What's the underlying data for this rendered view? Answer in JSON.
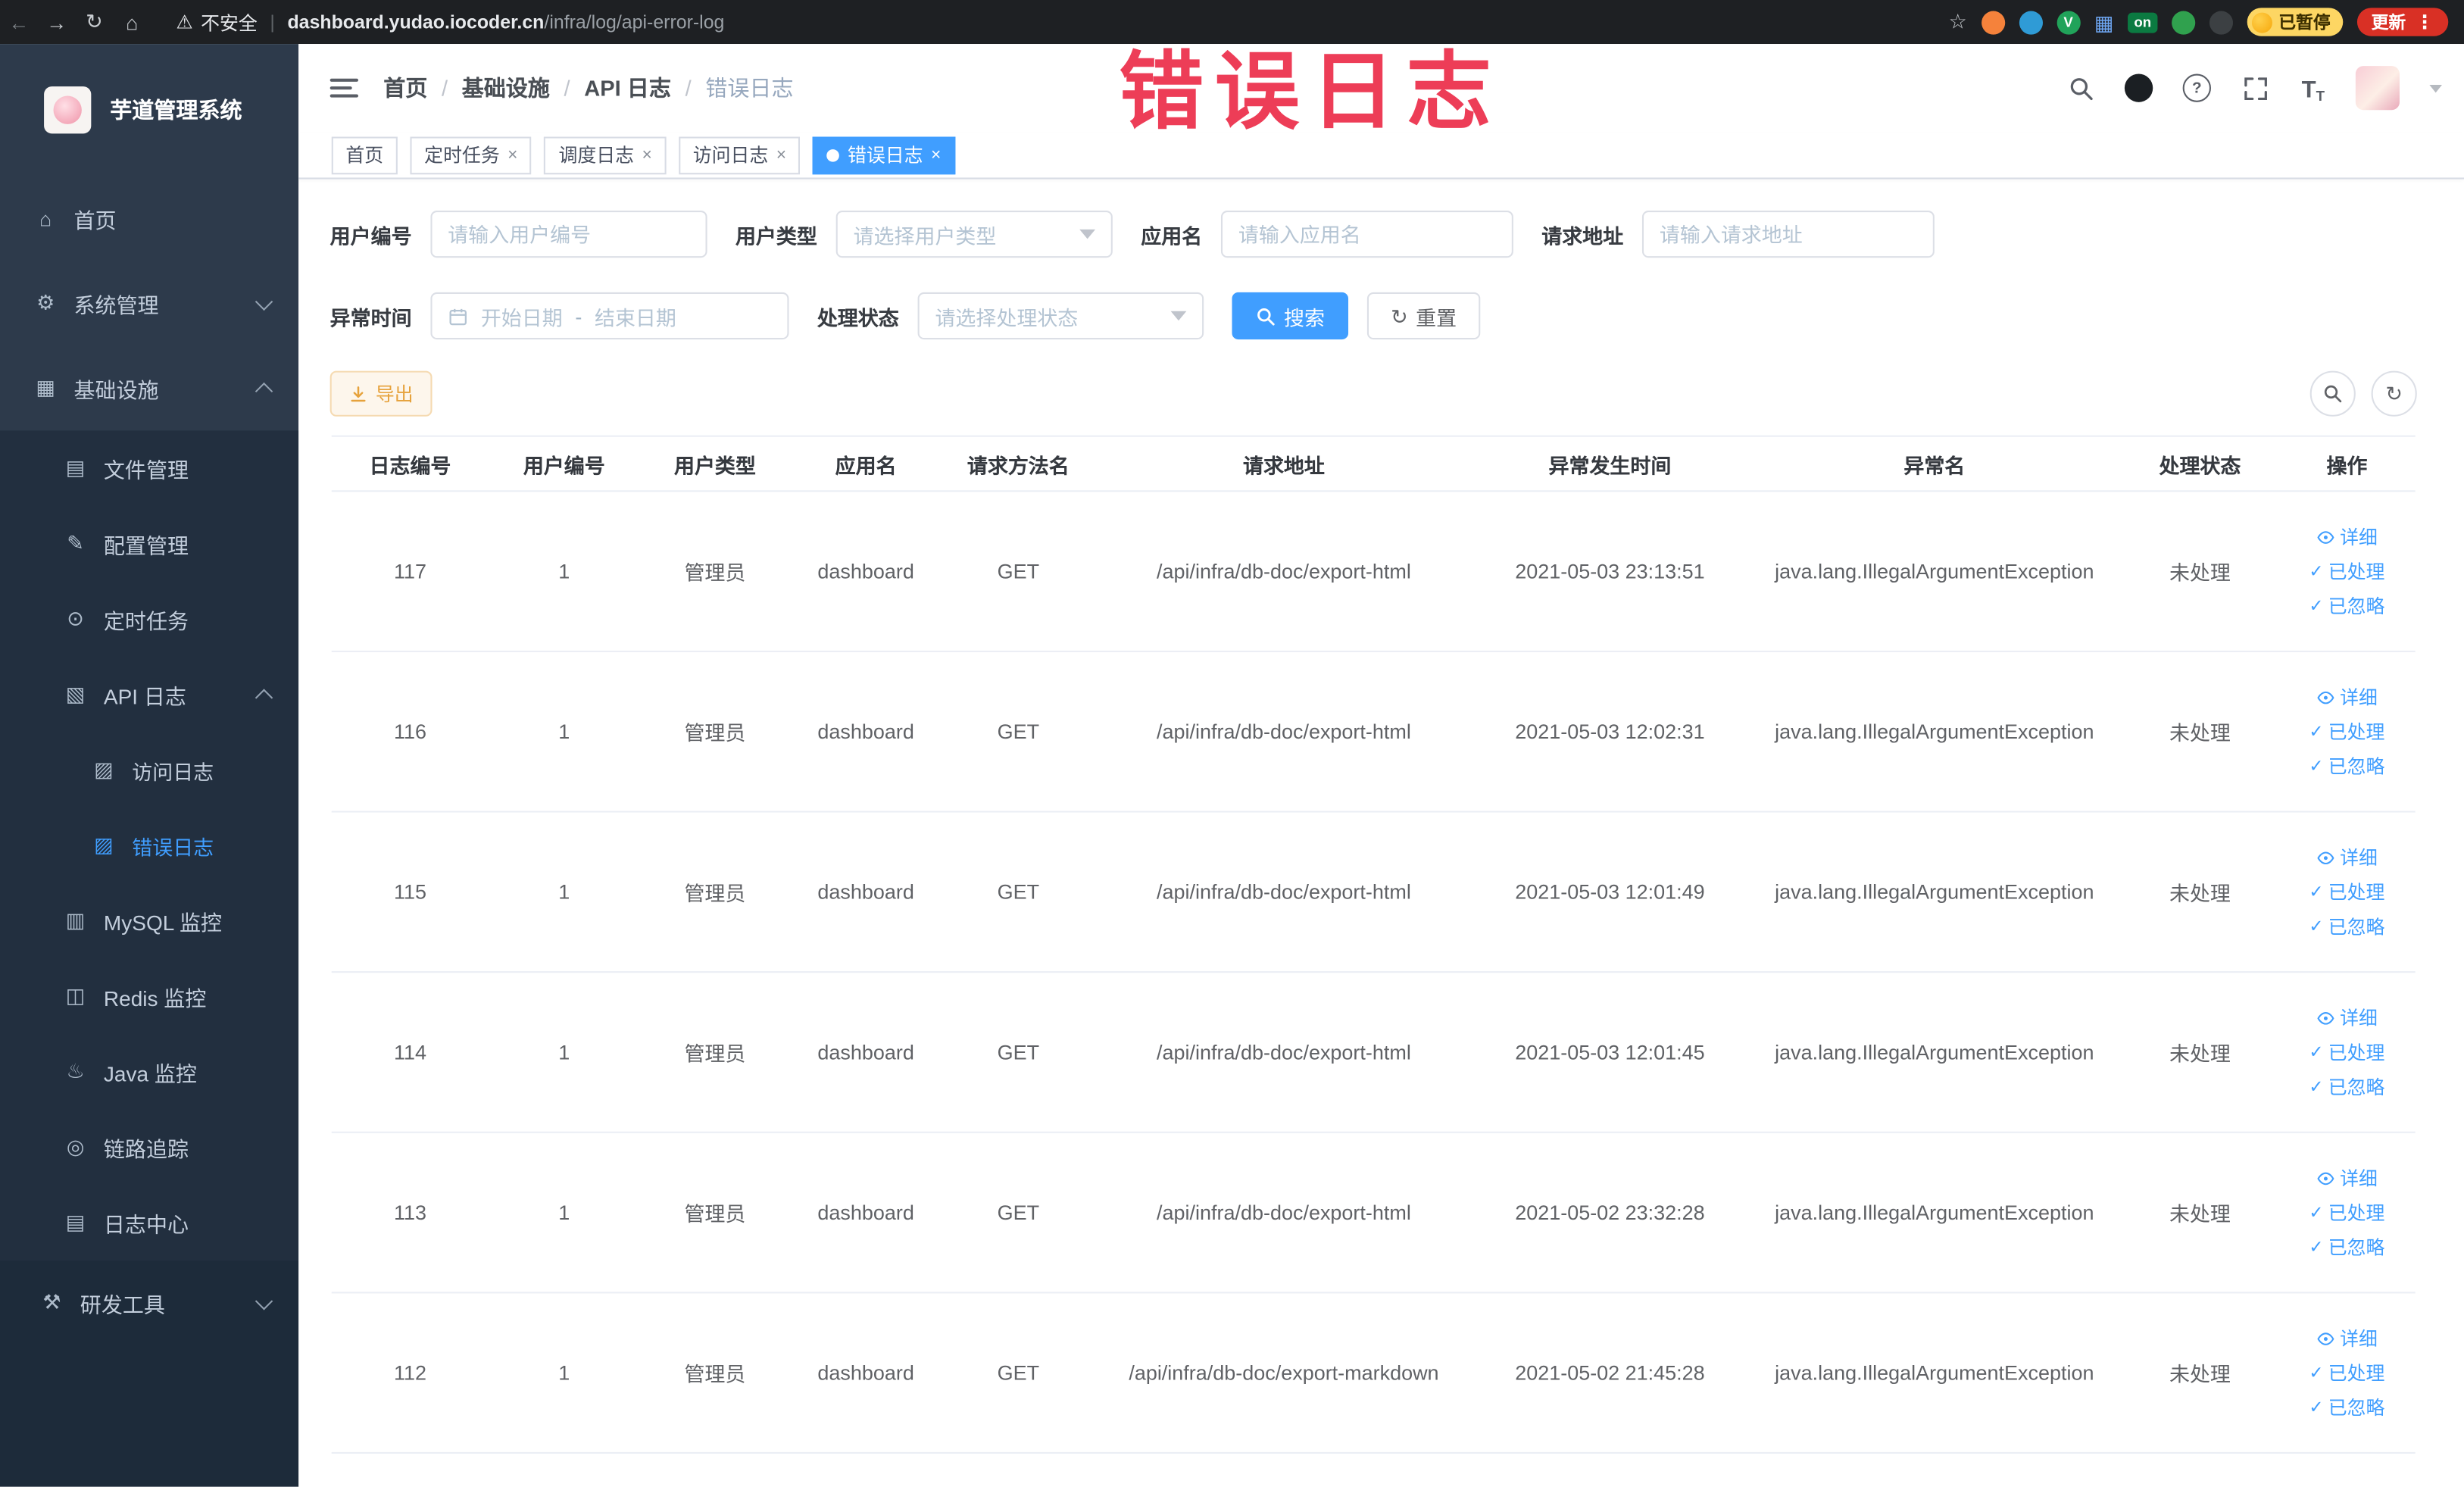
{
  "glyphs": {
    "back": "←",
    "forward": "→",
    "reload": "↻",
    "home": "⌂",
    "warning": "⚠",
    "star": "☆",
    "dots": "⋮",
    "check": "✓",
    "refresh": "↻",
    "question": "?",
    "grid": "▦",
    "close": "×",
    "download": "⤓",
    "magnifier_fallback": "⌕"
  },
  "browser": {
    "security_label": "不安全",
    "url_domain": "dashboard.yudao.iocoder.cn",
    "url_path": "/infra/log/api-error-log",
    "paused_badge": "已暂停",
    "update_label": "更新",
    "ext_on_label": "on",
    "ext_v_label": "V"
  },
  "annotation": {
    "overlay_text": "错误日志",
    "color": "#ed3d57"
  },
  "sidebar": {
    "logo_title": "芋道管理系统",
    "items": {
      "home": {
        "label": "首页",
        "glyph": "⌂"
      },
      "system": {
        "label": "系统管理",
        "glyph": "⚙"
      },
      "infra": {
        "label": "基础设施",
        "glyph": "▦"
      },
      "file": {
        "label": "文件管理",
        "glyph": "▤"
      },
      "config": {
        "label": "配置管理",
        "glyph": "✎"
      },
      "job": {
        "label": "定时任务",
        "glyph": "⊙"
      },
      "apilog": {
        "label": "API 日志",
        "glyph": "▧"
      },
      "accesslog": {
        "label": "访问日志",
        "glyph": "▨"
      },
      "errorlog": {
        "label": "错误日志",
        "glyph": "▨"
      },
      "mysql": {
        "label": "MySQL 监控",
        "glyph": "▥"
      },
      "redis": {
        "label": "Redis 监控",
        "glyph": "◫"
      },
      "java": {
        "label": "Java 监控",
        "glyph": "♨"
      },
      "trace": {
        "label": "链路追踪",
        "glyph": "◎"
      },
      "logcenter": {
        "label": "日志中心",
        "glyph": "▤"
      },
      "devtools": {
        "label": "研发工具",
        "glyph": "⚒"
      }
    }
  },
  "breadcrumb": {
    "separator": "/",
    "items": [
      "首页",
      "基础设施",
      "API 日志",
      "错误日志"
    ]
  },
  "tabs": {
    "home": "首页",
    "job": "定时任务",
    "joblog": "调度日志",
    "accesslog": "访问日志",
    "errorlog": "错误日志"
  },
  "filters": {
    "user_id": {
      "label": "用户编号",
      "placeholder": "请输入用户编号"
    },
    "user_type": {
      "label": "用户类型",
      "placeholder": "请选择用户类型"
    },
    "app_name": {
      "label": "应用名",
      "placeholder": "请输入应用名"
    },
    "request_url": {
      "label": "请求地址",
      "placeholder": "请输入请求地址"
    },
    "exception_time": {
      "label": "异常时间",
      "start_placeholder": "开始日期",
      "separator": "-",
      "end_placeholder": "结束日期"
    },
    "process_status": {
      "label": "处理状态",
      "placeholder": "请选择处理状态"
    },
    "search_label": "搜索",
    "reset_label": "重置"
  },
  "toolbar": {
    "export_label": "导出"
  },
  "table": {
    "columns": [
      "日志编号",
      "用户编号",
      "用户类型",
      "应用名",
      "请求方法名",
      "请求地址",
      "异常发生时间",
      "异常名",
      "处理状态",
      "操作"
    ],
    "row_actions": {
      "detail": "详细",
      "processed": "已处理",
      "ignore": "已忽略"
    },
    "rows": [
      [
        "117",
        "1",
        "管理员",
        "dashboard",
        "GET",
        "/api/infra/db-doc/export-html",
        "2021-05-03 23:13:51",
        "java.lang.IllegalArgumentException",
        "未处理"
      ],
      [
        "116",
        "1",
        "管理员",
        "dashboard",
        "GET",
        "/api/infra/db-doc/export-html",
        "2021-05-03 12:02:31",
        "java.lang.IllegalArgumentException",
        "未处理"
      ],
      [
        "115",
        "1",
        "管理员",
        "dashboard",
        "GET",
        "/api/infra/db-doc/export-html",
        "2021-05-03 12:01:49",
        "java.lang.IllegalArgumentException",
        "未处理"
      ],
      [
        "114",
        "1",
        "管理员",
        "dashboard",
        "GET",
        "/api/infra/db-doc/export-html",
        "2021-05-03 12:01:45",
        "java.lang.IllegalArgumentException",
        "未处理"
      ],
      [
        "113",
        "1",
        "管理员",
        "dashboard",
        "GET",
        "/api/infra/db-doc/export-html",
        "2021-05-02 23:32:28",
        "java.lang.IllegalArgumentException",
        "未处理"
      ],
      [
        "112",
        "1",
        "管理员",
        "dashboard",
        "GET",
        "/api/infra/db-doc/export-markdown",
        "2021-05-02 21:45:28",
        "java.lang.IllegalArgumentException",
        "未处理"
      ]
    ]
  }
}
